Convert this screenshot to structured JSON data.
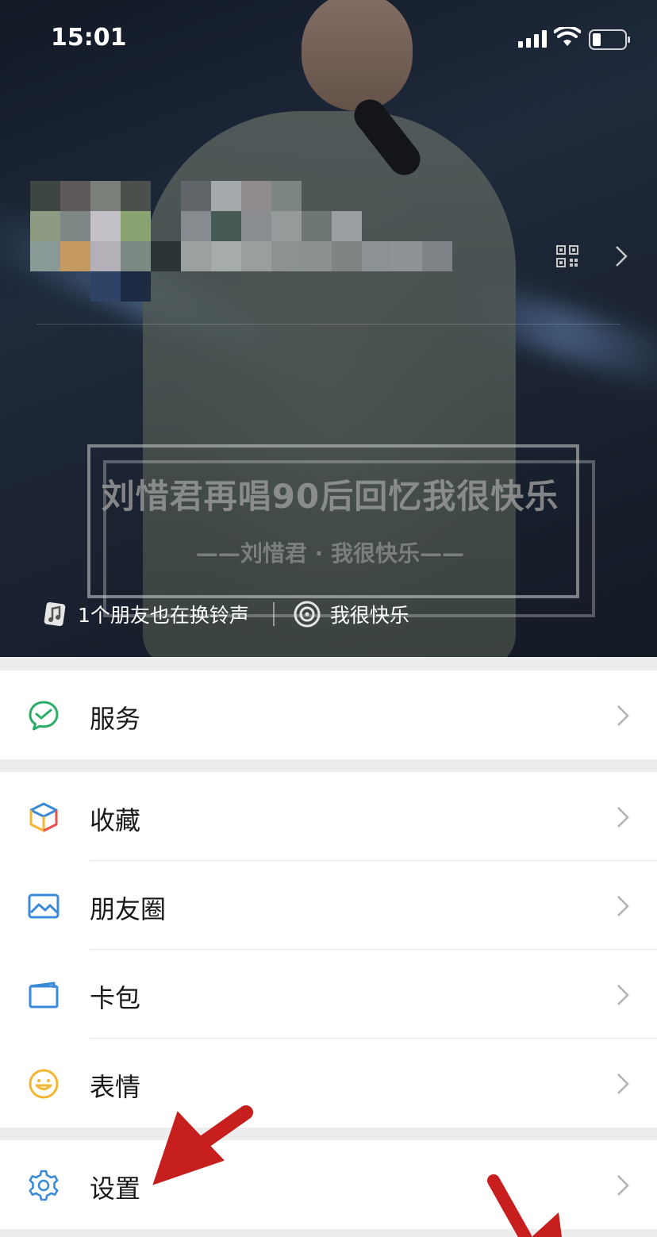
{
  "status_bar": {
    "time": "15:01"
  },
  "header": {
    "video_caption": {
      "title": "刘惜君再唱90后回忆我很快乐",
      "subtitle": "——刘惜君 · 我很快乐——"
    },
    "ringtone": {
      "friends_text": "1个朋友也在换铃声",
      "song": "我很快乐"
    }
  },
  "menu": {
    "group1": [
      {
        "label": "服务",
        "icon": "service-icon"
      }
    ],
    "group2": [
      {
        "label": "收藏",
        "icon": "favorites-cube-icon"
      },
      {
        "label": "朋友圈",
        "icon": "moments-image-icon"
      },
      {
        "label": "卡包",
        "icon": "card-wallet-icon"
      },
      {
        "label": "表情",
        "icon": "sticker-smiley-icon"
      }
    ],
    "group3": [
      {
        "label": "设置",
        "icon": "gear-icon"
      }
    ]
  },
  "colors": {
    "service_green": "#2aae67",
    "settings_blue": "#3a8ad8",
    "annotation_red": "#c71e1e",
    "chevron_gray": "#b2b2b2"
  }
}
